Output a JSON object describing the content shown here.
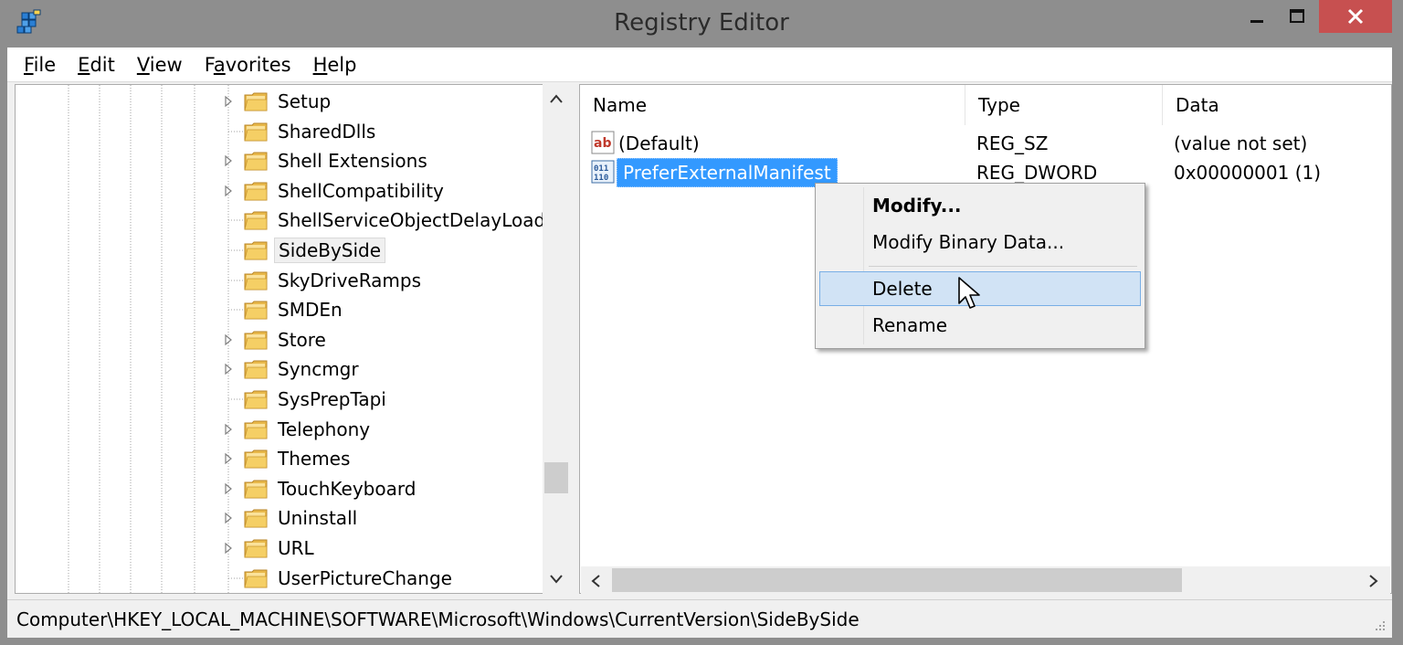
{
  "window": {
    "title": "Registry Editor"
  },
  "menu": [
    {
      "label": "File",
      "mnemonic": "F",
      "rest": "ile"
    },
    {
      "label": "Edit",
      "mnemonic": "E",
      "rest": "dit"
    },
    {
      "label": "View",
      "mnemonic": "V",
      "rest": "iew"
    },
    {
      "label": "Favorites",
      "pre": "F",
      "mnemonic": "a",
      "rest": "vorites"
    },
    {
      "label": "Help",
      "mnemonic": "H",
      "rest": "elp"
    }
  ],
  "tree": {
    "items": [
      {
        "label": "Setup",
        "expandable": true
      },
      {
        "label": "SharedDlls",
        "expandable": false
      },
      {
        "label": "Shell Extensions",
        "expandable": true
      },
      {
        "label": "ShellCompatibility",
        "expandable": true
      },
      {
        "label": "ShellServiceObjectDelayLoad",
        "expandable": false
      },
      {
        "label": "SideBySide",
        "expandable": false,
        "selected": true
      },
      {
        "label": "SkyDriveRamps",
        "expandable": false
      },
      {
        "label": "SMDEn",
        "expandable": false
      },
      {
        "label": "Store",
        "expandable": true
      },
      {
        "label": "Syncmgr",
        "expandable": true
      },
      {
        "label": "SysPrepTapi",
        "expandable": false
      },
      {
        "label": "Telephony",
        "expandable": true
      },
      {
        "label": "Themes",
        "expandable": true
      },
      {
        "label": "TouchKeyboard",
        "expandable": true
      },
      {
        "label": "Uninstall",
        "expandable": true
      },
      {
        "label": "URL",
        "expandable": true
      },
      {
        "label": "UserPictureChange",
        "expandable": false
      }
    ]
  },
  "values": {
    "columns": {
      "name": "Name",
      "type": "Type",
      "data": "Data"
    },
    "rows": [
      {
        "name": "(Default)",
        "type": "REG_SZ",
        "data": "(value not set)",
        "icon": "string-value-icon"
      },
      {
        "name": "PreferExternalManifest",
        "type": "REG_DWORD",
        "data": "0x00000001 (1)",
        "icon": "binary-value-icon",
        "selected": true
      }
    ]
  },
  "context_menu": {
    "modify": "Modify...",
    "modify_binary": "Modify Binary Data...",
    "delete": "Delete",
    "rename": "Rename",
    "hovered": "delete"
  },
  "status": {
    "path": "Computer\\HKEY_LOCAL_MACHINE\\SOFTWARE\\Microsoft\\Windows\\CurrentVersion\\SideBySide"
  },
  "colors": {
    "selection": "#3399ff",
    "menu_hover": "#d1e3f5",
    "close_button": "#c75050"
  }
}
